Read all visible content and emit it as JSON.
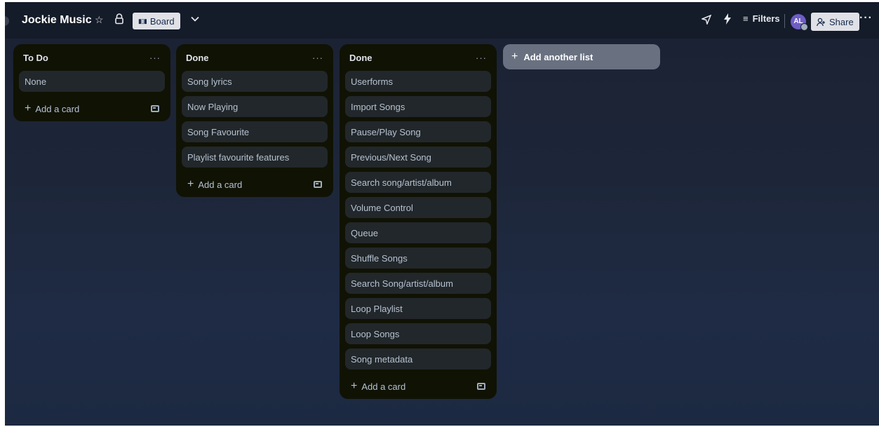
{
  "board": {
    "title": "Jockie Music",
    "view_label": "Board",
    "view_icon": "board-icon",
    "star_icon": "star-icon",
    "lock_icon": "lock-icon"
  },
  "header": {
    "filters_label": "Filters",
    "avatar_initials": "AL",
    "share_label": "Share",
    "more_label": "···"
  },
  "lists": [
    {
      "title": "To Do",
      "menu_label": "···",
      "cards": [
        "None"
      ],
      "add_card_label": "Add a card"
    },
    {
      "title": "Done",
      "menu_label": "···",
      "cards": [
        "Song lyrics",
        "Now Playing",
        "Song Favourite",
        "Playlist favourite features"
      ],
      "add_card_label": "Add a card"
    },
    {
      "title": "Done",
      "menu_label": "···",
      "cards": [
        "Userforms",
        "Import Songs",
        "Pause/Play Song",
        "Previous/Next Song",
        "Search song/artist/album",
        "Volume Control",
        "Queue",
        "Shuffle Songs",
        "Search Song/artist/album",
        "Loop Playlist",
        "Loop Songs",
        "Song metadata"
      ],
      "add_card_label": "Add a card"
    }
  ],
  "add_list_label": "Add another list",
  "colors": {
    "list_bg": "#101204",
    "card_bg": "#22272b",
    "board_bg_top": "#1a2133",
    "board_bg_bottom": "#1c2941",
    "avatar_bg": "#6e5dc6"
  }
}
